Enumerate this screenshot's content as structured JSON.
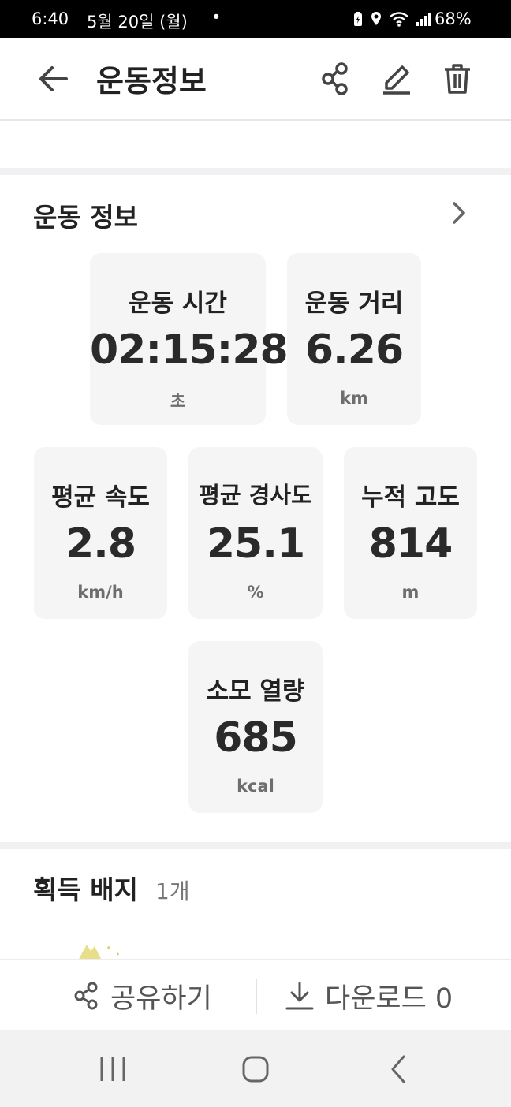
{
  "status_bar": {
    "time": "6:40",
    "date": "5월 20일 (월)",
    "dot": "•",
    "battery": "68%",
    "icons": [
      "battery-saver-icon",
      "location-icon",
      "wifi-icon",
      "signal-icon"
    ]
  },
  "header": {
    "title": "운동정보",
    "icons": [
      "back-arrow-icon",
      "share-icon",
      "edit-icon",
      "trash-icon"
    ]
  },
  "exercise_info": {
    "section_title": "운동 정보",
    "stats": [
      {
        "label": "운동 시간",
        "value": "02:15:28",
        "unit": "초"
      },
      {
        "label": "운동 거리",
        "value": "6.26",
        "unit": "km"
      },
      {
        "label": "평균 속도",
        "value": "2.8",
        "unit": "km/h"
      },
      {
        "label": "평균 경사도",
        "value": "25.1",
        "unit": "%"
      },
      {
        "label": "누적 고도",
        "value": "814",
        "unit": "m"
      },
      {
        "label": "소모 열량",
        "value": "685",
        "unit": "kcal"
      }
    ]
  },
  "badges": {
    "title": "획득 배지",
    "count": "1개"
  },
  "bottom_bar": {
    "share_label": "공유하기",
    "download_label": "다운로드 0"
  },
  "nav_bar": {
    "buttons": [
      "recent-apps-icon",
      "home-icon",
      "back-icon"
    ]
  },
  "colors": {
    "card_bg": "#f5f5f5",
    "text": "#222222",
    "muted": "#6e6e6e",
    "divider": "#f1f1f3"
  }
}
